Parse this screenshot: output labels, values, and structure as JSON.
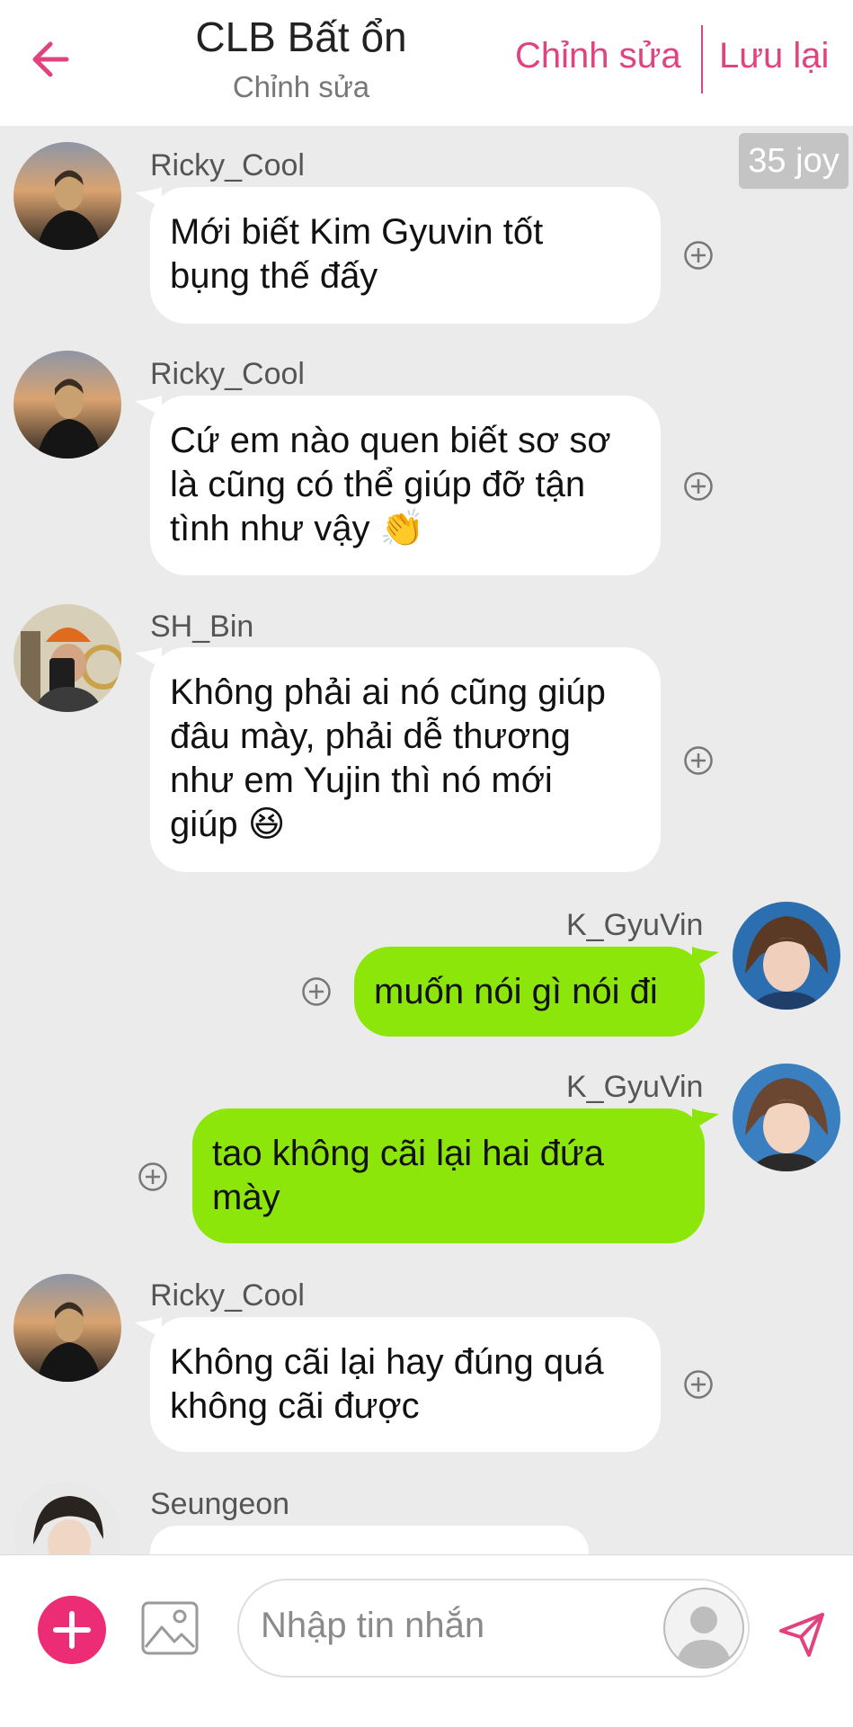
{
  "header": {
    "title": "CLB Bất ổn",
    "subtitle": "Chỉnh sửa",
    "edit_label": "Chỉnh sửa",
    "save_label": "Lưu lại"
  },
  "badge": "35 joy",
  "messages": [
    {
      "sender": "Ricky_Cool",
      "lines": [
        "Mới biết Kim Gyuvin tốt",
        "bụng thế đấy"
      ],
      "direction": "incoming"
    },
    {
      "sender": "Ricky_Cool",
      "lines": [
        "Cứ em nào quen biết sơ sơ",
        "là cũng có thể giúp đỡ tận",
        "tình như vậy 👏"
      ],
      "direction": "incoming"
    },
    {
      "sender": "SH_Bin",
      "lines": [
        "Không phải ai nó cũng giúp",
        "đâu mày, phải dễ thương",
        "như em Yujin thì nó mới",
        "giúp 😆"
      ],
      "direction": "incoming"
    },
    {
      "sender": "K_GyuVin",
      "lines": [
        "muốn nói gì nói đi"
      ],
      "direction": "outgoing"
    },
    {
      "sender": "K_GyuVin",
      "lines": [
        "tao không cãi lại hai đứa",
        "mày"
      ],
      "direction": "outgoing"
    },
    {
      "sender": "Ricky_Cool",
      "lines": [
        "Không cãi lại hay đúng quá",
        "không cãi được"
      ],
      "direction": "incoming"
    },
    {
      "sender": "Seungeon",
      "lines": [],
      "direction": "incoming"
    }
  ],
  "composer": {
    "placeholder": "Nhập tin nhắn"
  },
  "colors": {
    "accent": "#e0437f",
    "add_button": "#ec2c75",
    "outgoing_bubble": "#8de60a",
    "incoming_bubble": "#ffffff",
    "background": "#ebebeb"
  },
  "icons": {
    "back": "arrow-left-icon",
    "add": "plus-icon",
    "image": "image-icon",
    "profile": "profile-icon",
    "send": "send-icon",
    "reaction": "add-reaction-icon"
  }
}
